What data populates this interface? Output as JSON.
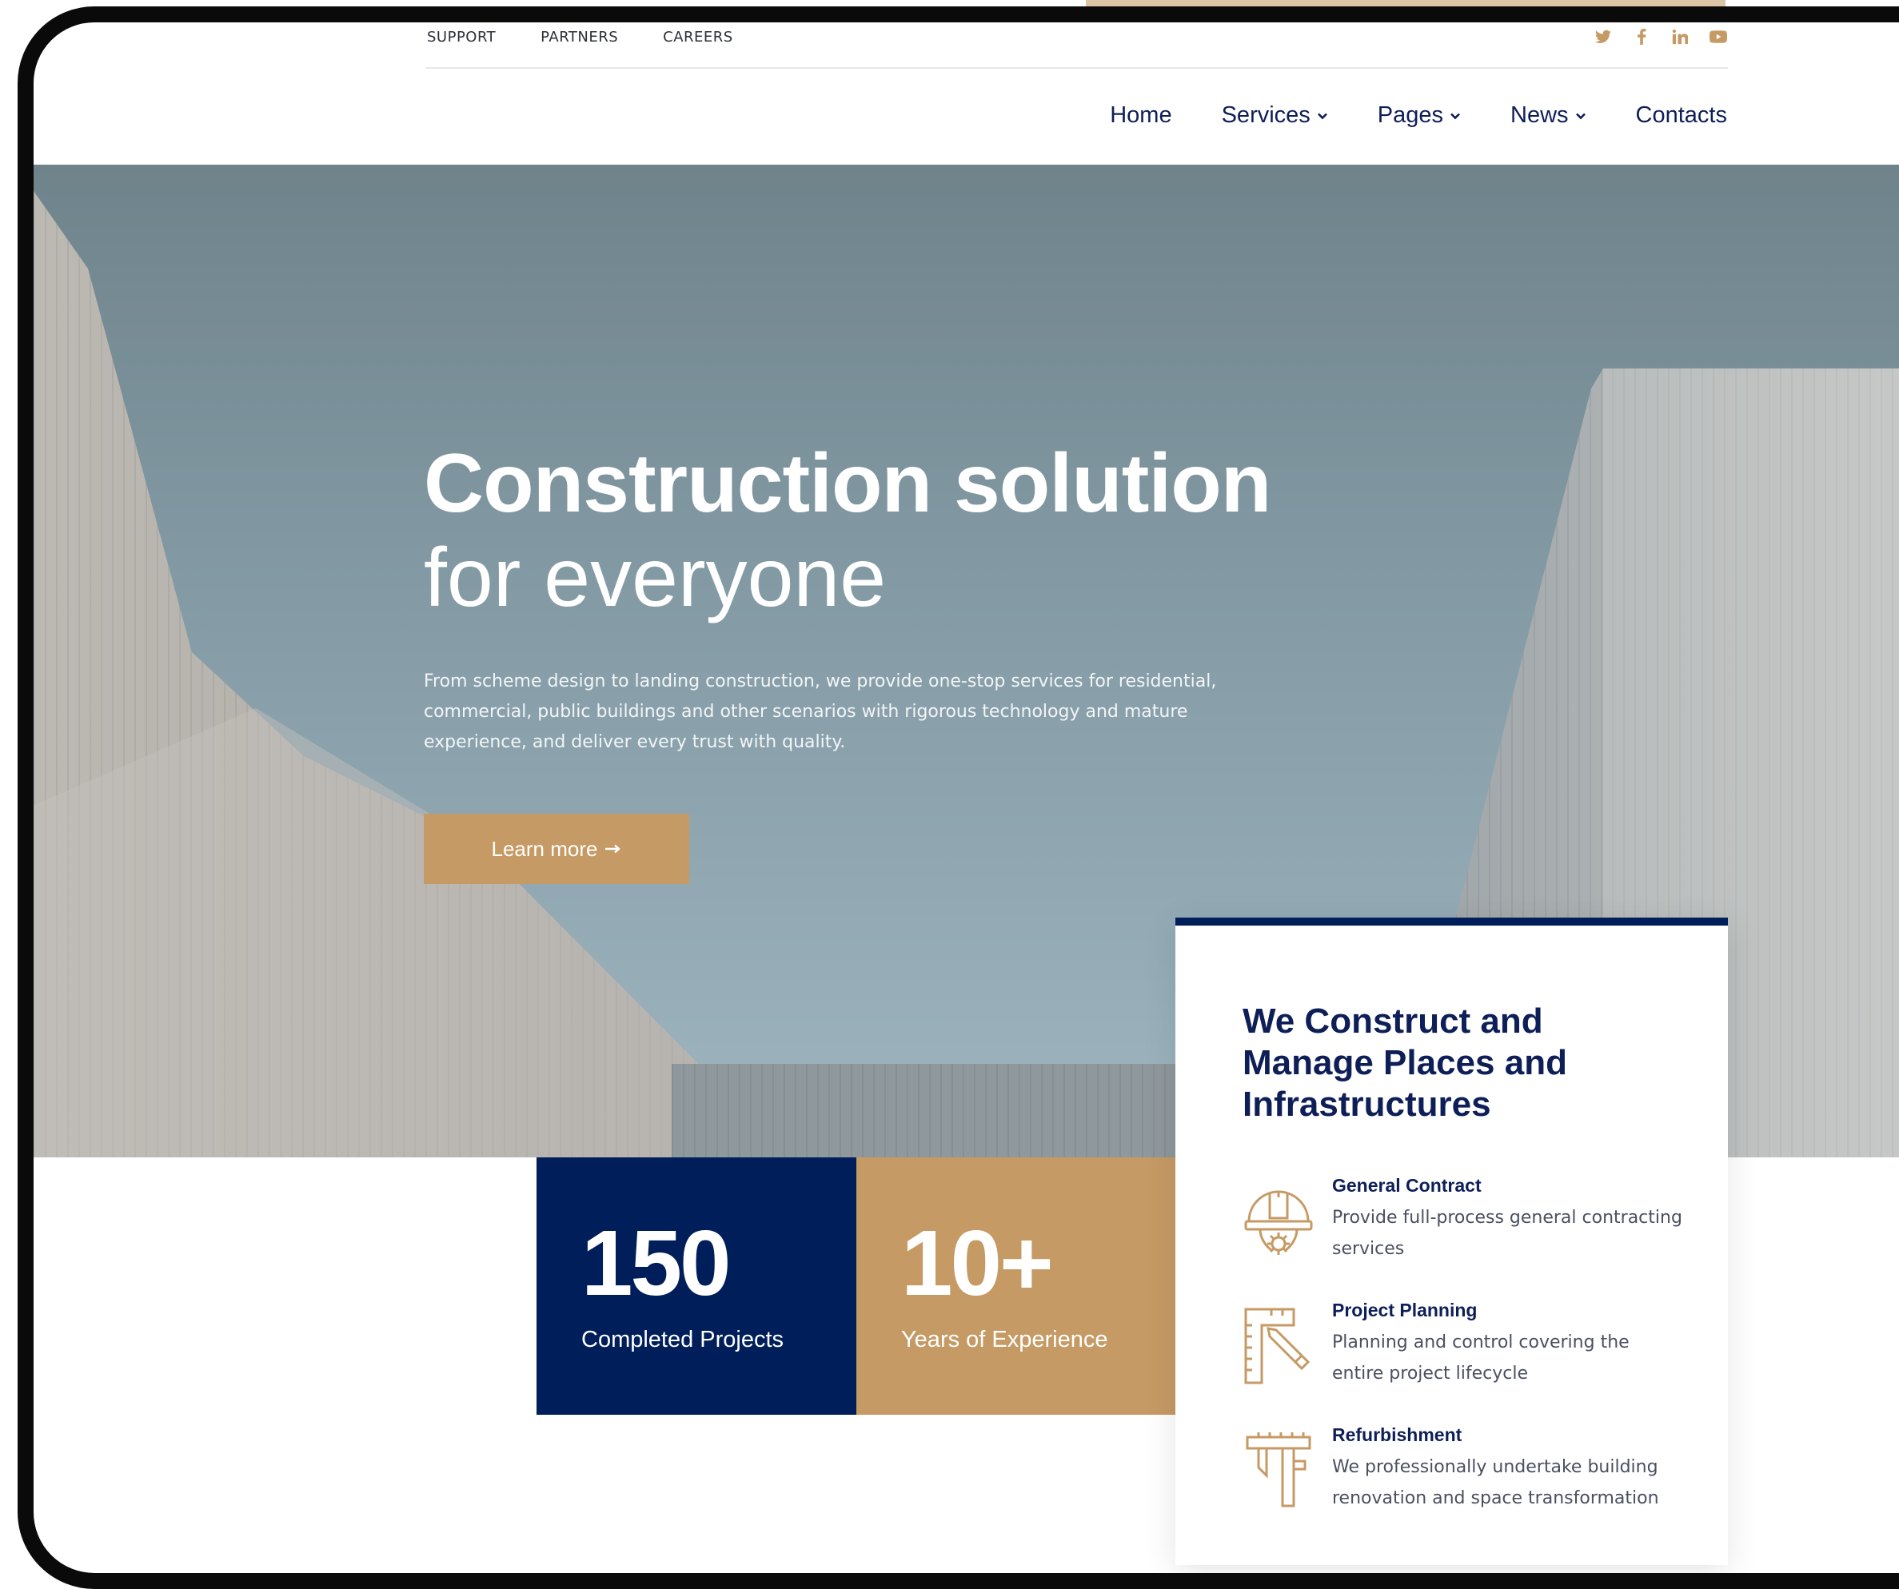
{
  "utility_nav": {
    "links": [
      "SUPPORT",
      "PARTNERS",
      "CAREERS"
    ],
    "social_icons": [
      "twitter-icon",
      "facebook-icon",
      "linkedin-icon",
      "youtube-icon"
    ]
  },
  "main_nav": {
    "items": [
      {
        "label": "Home",
        "has_dropdown": false
      },
      {
        "label": "Services",
        "has_dropdown": true
      },
      {
        "label": "Pages",
        "has_dropdown": true
      },
      {
        "label": "News",
        "has_dropdown": true
      },
      {
        "label": "Contacts",
        "has_dropdown": false
      }
    ]
  },
  "hero": {
    "title_line1": "Construction solution",
    "title_line2": "for everyone",
    "description": "From scheme design to landing construction, we provide one-stop services for residential, commercial, public buildings and other scenarios with rigorous technology and mature experience, and deliver every trust with quality.",
    "cta_label": "Learn more",
    "cta_icon": "arrow-right-icon"
  },
  "stats": [
    {
      "value": "150",
      "label": "Completed Projects",
      "color": "#001e5a"
    },
    {
      "value": "10+",
      "label": "Years of Experience",
      "color": "#c69a64"
    }
  ],
  "card": {
    "title": "We Construct and Manage Places and Infrastructures",
    "features": [
      {
        "icon": "hard-hat-gear-icon",
        "title": "General Contract",
        "description": "Provide full-process general contracting services"
      },
      {
        "icon": "square-ruler-pencil-icon",
        "title": "Project Planning",
        "description": "Planning and control covering the entire project lifecycle"
      },
      {
        "icon": "caliper-icon",
        "title": "Refurbishment",
        "description": "We professionally undertake building renovation and space transformation"
      }
    ]
  },
  "colors": {
    "brand_navy": "#001e5a",
    "accent_gold": "#c69a64",
    "nav_text": "#0e1f58"
  }
}
